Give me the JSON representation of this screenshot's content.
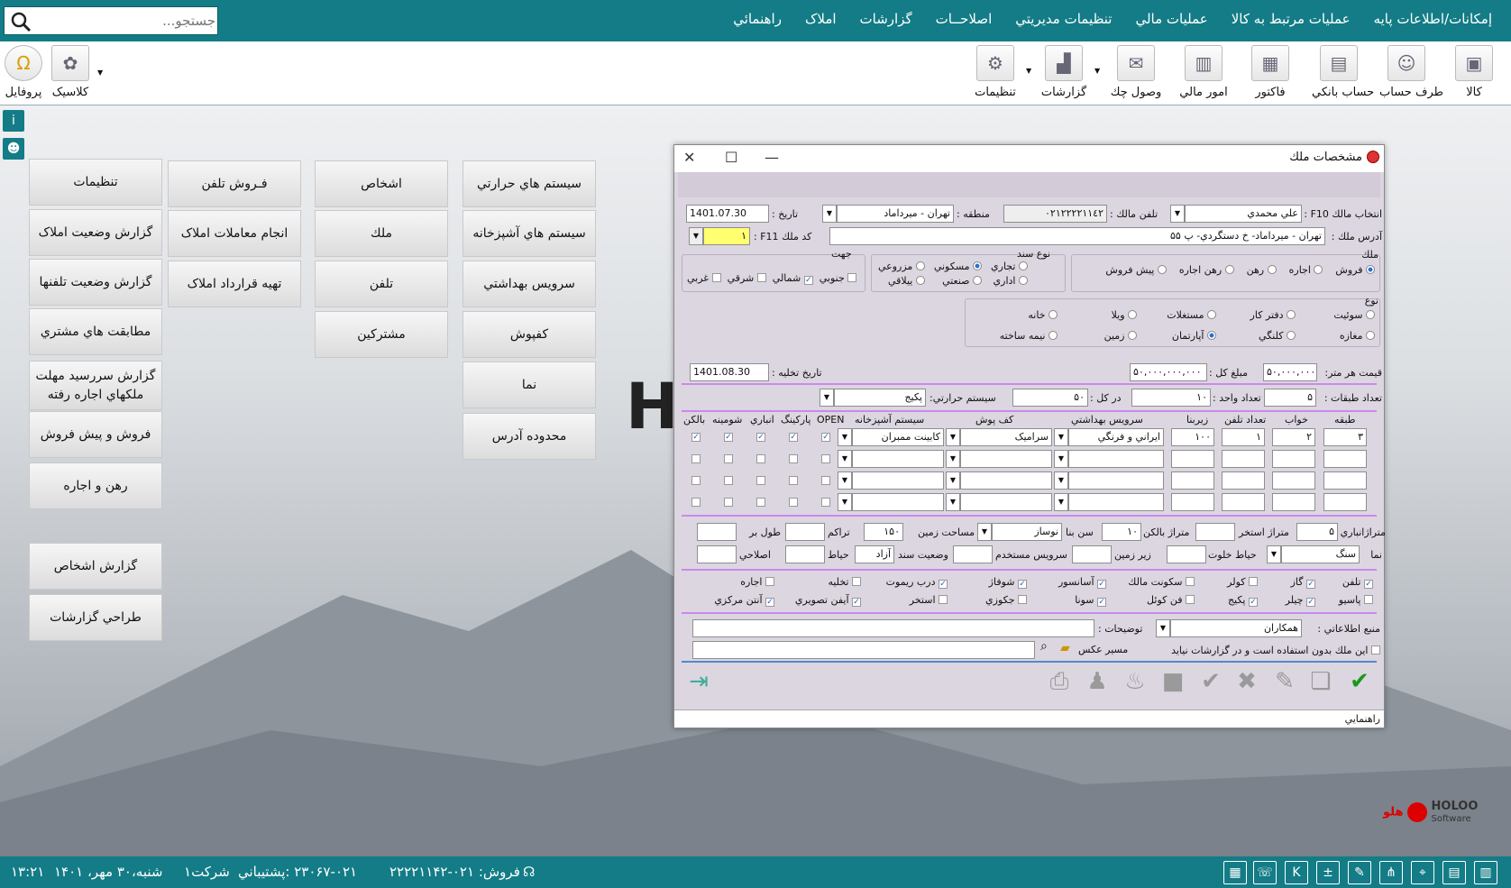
{
  "menu": [
    "إمكانات/اطلاعات پايه",
    "عمليات مرتبط به كالا",
    "عمليات مالي",
    "تنظيمات مديريتي",
    "اصلاحــات",
    "گزارشات",
    "املاک",
    "راهنمائي"
  ],
  "search": {
    "placeholder": "جستجو..."
  },
  "toolbar": {
    "kala": "كالا",
    "taraf": "طرف حساب",
    "bank": "حساب بانكي",
    "factor": "فاكتور",
    "mali": "امور مالي",
    "vosul": "وصول چك",
    "reports": "گزارشات",
    "settings": "تنظيمات",
    "classic": "كلاسيک",
    "profile": "پروفايل"
  },
  "left_buttons": [
    "سيستم هاي حرارتي",
    "سيستم هاي آشپزخانه",
    "سرويس بهداشتي",
    "كفپوش",
    "نما",
    "محدوده آدرس",
    "اشخاص",
    "ملك",
    "تلفن",
    "مشتركين",
    "فـروش تلفن",
    "انجام معاملات املاک",
    "تهيه قرارداد املاک",
    "تنظيمات",
    "گزارش وضعيت املاک",
    "گزارش وضعيت تلفنها",
    "مطابقت هاي مشتري",
    "گزارش سررسيد مهلت ملكهاي اجاره رفته",
    "فروش و  پيش فروش",
    "رهن و اجاره",
    "گزارش اشخاص",
    "طراحي گزارشات"
  ],
  "dialog": {
    "title": "مشخصات ملك",
    "owner_label": "انتخاب مالك F10 :",
    "owner": "علي محمدي",
    "phone_label": "تلفن مالك :",
    "phone": "٠٢١٢٢٢٢١١٤٢",
    "region_label": "منطقه :",
    "region": "تهران - ميرداماد",
    "date_label": "تاريخ :",
    "date": "1401.07.30",
    "address_label": "آدرس ملك :",
    "address": "تهران - ميرداماد- خ دستگردي- پ ۵۵",
    "code_label": "كد ملك F11 :",
    "code": "١",
    "g_melk": "ملك",
    "melk_opts": [
      "فروش",
      "اجاره",
      "رهن",
      "رهن اجاره",
      "پيش فروش"
    ],
    "g_sanad": "نوع سند",
    "sanad_opts": [
      "تجاري",
      "مسكوني",
      "مزروعي",
      "اداري",
      "صنعتي",
      "ييلاقي"
    ],
    "g_jahat": "جهت",
    "jahat_opts": [
      "جنوبي",
      "شمالي",
      "شرقي",
      "غربي"
    ],
    "g_noe": "نوع",
    "noe_opts": [
      "سوئيت",
      "دفتر كار",
      "مستغلات",
      "ويلا",
      "خانه",
      "مغازه",
      "كلنگي",
      "آپارتمان",
      "زمين",
      "نيمه ساخته"
    ],
    "price_m_label": "قيمت هر متر:",
    "price_m": "۵٠,٠٠٠,٠٠٠",
    "total_label": "مبلغ كل :",
    "total": "۵٠,٠٠٠,٠٠٠,٠٠٠",
    "evac_label": "تاريخ تخليه :",
    "evac": "1401.08.30",
    "floors_label": "تعداد طبقات :",
    "floors": "۵",
    "units_label": "تعداد واحد :",
    "units": "١٠",
    "inall_label": "در كل :",
    "inall": "۵٠",
    "heat_label": "سيستم حرارتي:",
    "heat": "پكيج",
    "cols": [
      "طبقه",
      "خواب",
      "تعداد تلفن",
      "زيربنا",
      "سرويس بهداشتي",
      "كف پوش",
      "سيستم آشپزخانه",
      "OPEN",
      "پاركينگ",
      "انباري",
      "شومينه",
      "بالكن"
    ],
    "row1": [
      "٣",
      "٢",
      "١",
      "١٠٠",
      "ايراني و فرنگي",
      "سراميک",
      "كابينت ممبران"
    ],
    "f_anbar_label": "متراژانباري",
    "f_anbar": "۵",
    "f_pool_label": "متراژ استخر",
    "f_balcony_label": "متراژ بالكن",
    "f_balcony": "١٠",
    "f_age_label": "سن بنا",
    "f_age": "نوساز",
    "f_land_label": "مساحت زمين",
    "f_land": "١۵٠",
    "f_density_label": "تراكم",
    "f_length_label": "طول بر",
    "f_facade_label": "نما",
    "f_facade": "سنگ",
    "f_yard_label": "حياط خلوت",
    "f_under_label": "زير زمين",
    "f_service_label": "سرويس مستخدم",
    "f_doc_label": "وضعيت سند",
    "f_doc": "آزاد",
    "f_yard2_label": "حياط",
    "f_fix_label": "اصلاحي",
    "amen1": [
      "تلفن",
      "گاز",
      "كولر",
      "سكونت مالك",
      "آسانسور",
      "شوفاژ",
      "درب ريموت",
      "تخليه",
      "اجاره"
    ],
    "amen2": [
      "پاسيو",
      "چيلر",
      "پكيج",
      "فن كوئل",
      "سونا",
      "جكوزي",
      "استخر",
      "آيفن تصويري",
      "آنتن مركزي"
    ],
    "source_label": "منبع اطلاعاتي :",
    "source": "همكاران",
    "desc_label": "توضيحات :",
    "photo_label": "مسير عكس",
    "unused_label": "اين ملك بدون استفاده است و در گزارشات نيايد",
    "help": "راهنمايي"
  },
  "status": {
    "time": "١٣:٢١",
    "date": "شنبه،٣٠ مهر، ١۴٠١",
    "company": "شركت١",
    "support": "٠٢١-٢٣٠۶٧ :پشتيباني",
    "sales": "فروش:  ٠٢١-٢٢٢٢١١۴٢"
  },
  "brand": {
    "name": "HOLOO",
    "sub": "Software",
    "fa": "هلو"
  }
}
